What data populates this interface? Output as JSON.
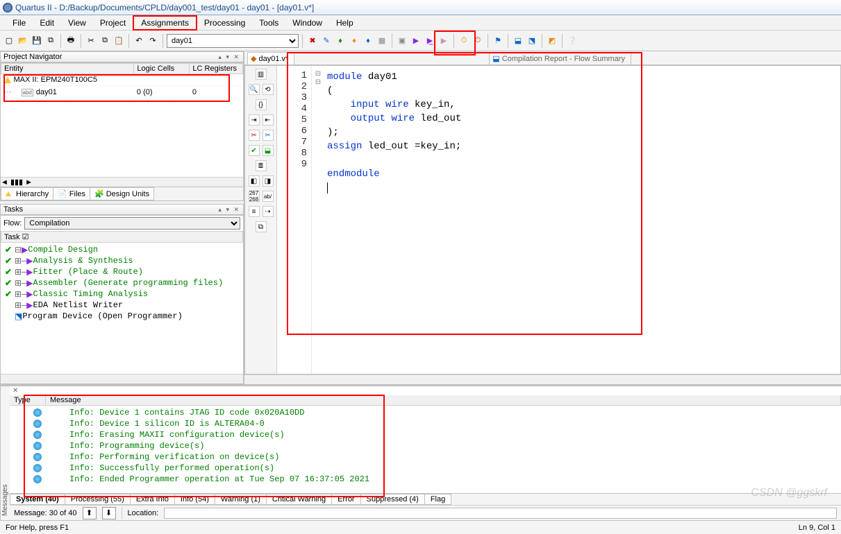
{
  "window": {
    "title": "Quartus II - D:/Backup/Documents/CPLD/day001_test/day01 - day01 - [day01.v*]"
  },
  "menu": {
    "file": "File",
    "edit": "Edit",
    "view": "View",
    "project": "Project",
    "assignments": "Assignments",
    "processing": "Processing",
    "tools": "Tools",
    "window": "Window",
    "help": "Help"
  },
  "toolbar": {
    "project_selected": "day01"
  },
  "navigator": {
    "title": "Project Navigator",
    "cols": {
      "entity": "Entity",
      "logic_cells": "Logic Cells",
      "lc_registers": "LC Registers"
    },
    "rows": [
      {
        "entity": "MAX II: EPM240T100C5",
        "lc": "",
        "reg": ""
      },
      {
        "entity": "day01",
        "lc": "0 (0)",
        "reg": "0"
      }
    ],
    "tabs": {
      "hierarchy": "Hierarchy",
      "files": "Files",
      "design_units": "Design Units"
    }
  },
  "tasks": {
    "title": "Tasks",
    "flow_label": "Flow:",
    "flow_value": "Compilation",
    "header": "Task ☑",
    "items": [
      {
        "check": true,
        "label": "Compile Design"
      },
      {
        "check": true,
        "label": "Analysis & Synthesis"
      },
      {
        "check": true,
        "label": "Fitter (Place & Route)"
      },
      {
        "check": true,
        "label": "Assembler (Generate programming files)"
      },
      {
        "check": true,
        "label": "Classic Timing Analysis"
      },
      {
        "check": false,
        "label": "EDA Netlist Writer"
      },
      {
        "check": false,
        "label": "Program Device (Open Programmer)"
      }
    ]
  },
  "tabs": {
    "active": "day01.v*",
    "inactive": "Compilation Report - Flow Summary"
  },
  "code": {
    "lines": [
      "1",
      "2",
      "3",
      "4",
      "5",
      "6",
      "7",
      "8",
      "9"
    ],
    "l1_kw": "module",
    "l1_rest": " day01",
    "l2": "(",
    "l3_pre": "    ",
    "l3_kw": "input wire",
    "l3_rest": " key_in,",
    "l4_pre": "    ",
    "l4_kw": "output wire",
    "l4_rest": " led_out",
    "l5": ");",
    "l6_kw": "assign",
    "l6_rest": " led_out =key_in;",
    "l7": "",
    "l8_kw": "endmodule",
    "l9": ""
  },
  "messages": {
    "vlabel": "Messages",
    "cols": {
      "type": "Type",
      "message": "Message"
    },
    "rows": [
      "Info: Device 1 contains JTAG ID code 0x020A10DD",
      "Info: Device 1 silicon ID is ALTERA04-0",
      "Info: Erasing MAXII configuration device(s)",
      "Info: Programming device(s)",
      "Info: Performing verification on device(s)",
      "Info: Successfully performed operation(s)",
      "Info: Ended Programmer operation at Tue Sep 07 16:37:05 2021"
    ],
    "tabs": {
      "system": "System (40)",
      "processing": "Processing (55)",
      "extra": "Extra Info",
      "info": "Info (54)",
      "warning": "Warning (1)",
      "critical": "Critical Warning",
      "error": "Error",
      "suppressed": "Suppressed (4)",
      "flag": "Flag"
    },
    "status": {
      "count": "Message: 30 of 40",
      "loc_label": "Location:"
    }
  },
  "statusbar": {
    "help": "For Help, press F1",
    "pos": "Ln 9, Col 1"
  },
  "watermark": "CSDN @ggskrf"
}
